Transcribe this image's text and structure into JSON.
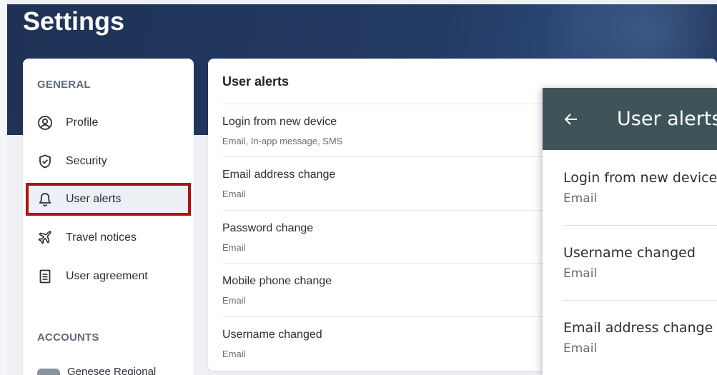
{
  "page": {
    "title": "Settings"
  },
  "sidebar": {
    "general_label": "GENERAL",
    "items": [
      {
        "label": "Profile",
        "icon": "profile-icon",
        "active": false
      },
      {
        "label": "Security",
        "icon": "shield-icon",
        "active": false
      },
      {
        "label": "User alerts",
        "icon": "bell-icon",
        "active": true
      },
      {
        "label": "Travel notices",
        "icon": "airplane-icon",
        "active": false
      },
      {
        "label": "User agreement",
        "icon": "document-icon",
        "active": false
      }
    ],
    "accounts_label": "ACCOUNTS",
    "account_name": "Genesee Regional"
  },
  "main": {
    "title": "User alerts",
    "alerts": [
      {
        "title": "Login from new device",
        "channels": "Email, In-app message, SMS"
      },
      {
        "title": "Email address change",
        "channels": "Email"
      },
      {
        "title": "Password change",
        "channels": "Email"
      },
      {
        "title": "Mobile phone change",
        "channels": "Email"
      },
      {
        "title": "Username changed",
        "channels": "Email"
      }
    ]
  },
  "mobile": {
    "title": "User alerts",
    "alerts": [
      {
        "title": "Login from new device",
        "channels": "Email"
      },
      {
        "title": "Username changed",
        "channels": "Email"
      },
      {
        "title": "Email address change",
        "channels": "Email"
      }
    ]
  },
  "colors": {
    "hero": "#233a63",
    "active_outline": "#b40f12",
    "mobile_header": "#3f5459"
  }
}
